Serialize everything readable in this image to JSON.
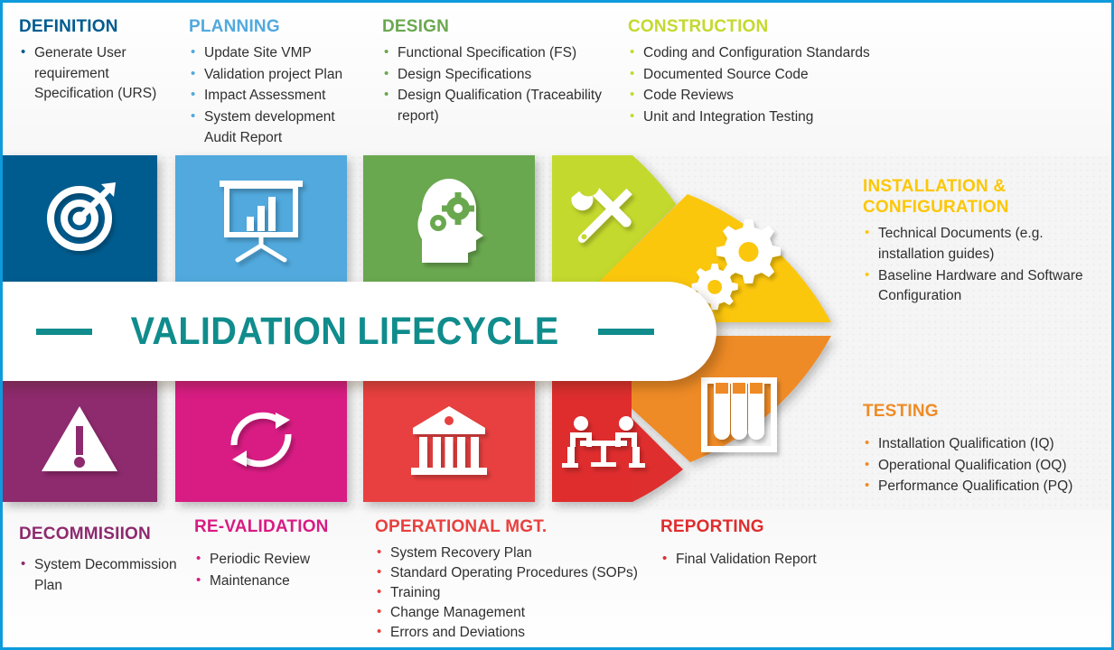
{
  "banner": {
    "title": "VALIDATION LIFECYCLE",
    "accent_color": "#108c8c"
  },
  "frame": {
    "border_color": "#0d9bdb",
    "background": "#f5f5f5"
  },
  "stages": [
    {
      "id": "definition",
      "heading": "DEFINITION",
      "color": "#005b8f",
      "icon": "target-icon",
      "items": [
        "Generate User requirement Specification (URS)"
      ]
    },
    {
      "id": "planning",
      "heading": "PLANNING",
      "color": "#51a9dd",
      "icon": "presentation-chart-icon",
      "items": [
        "Update Site VMP",
        "Validation project Plan",
        "Impact Assessment",
        "System development Audit Report"
      ]
    },
    {
      "id": "design",
      "heading": "DESIGN",
      "color": "#6aa84f",
      "icon": "head-gears-icon",
      "items": [
        "Functional Specification (FS)",
        "Design Specifications",
        "Design Qualification (Traceability report)"
      ]
    },
    {
      "id": "construction",
      "heading": "CONSTRUCTION",
      "color": "#c4d92e",
      "icon": "tools-icon",
      "items": [
        "Coding and Configuration Standards",
        "Documented Source Code",
        "Code Reviews",
        "Unit and Integration Testing"
      ]
    },
    {
      "id": "installation",
      "heading": "INSTALLATION & CONFIGURATION",
      "color": "#fbc707",
      "icon": "gears-icon",
      "items": [
        "Technical Documents (e.g. installation guides)",
        "Baseline Hardware and Software Configuration"
      ]
    },
    {
      "id": "testing",
      "heading": "TESTING",
      "color": "#ef8b26",
      "icon": "test-tubes-icon",
      "items": [
        "Installation Qualification (IQ)",
        "Operational Qualification (OQ)",
        "Performance Qualification (PQ)"
      ]
    },
    {
      "id": "reporting",
      "heading": "REPORTING",
      "color": "#df2d2e",
      "icon": "meeting-icon",
      "items": [
        "Final Validation Report"
      ]
    },
    {
      "id": "operational",
      "heading": "OPERATIONAL  MGT.",
      "color": "#e8413f",
      "icon": "institution-icon",
      "items": [
        "System Recovery Plan",
        "Standard Operating Procedures (SOPs)",
        "Training",
        "Change Management",
        "Errors and Deviations"
      ]
    },
    {
      "id": "revalidation",
      "heading": "RE-VALIDATION",
      "color": "#d81b83",
      "icon": "refresh-cycle-icon",
      "items": [
        "Periodic Review",
        "Maintenance"
      ]
    },
    {
      "id": "decommission",
      "heading": "DECOMMISIION",
      "color": "#8e2a6e",
      "icon": "warning-triangle-icon",
      "items": [
        "System Decommission Plan"
      ]
    }
  ]
}
